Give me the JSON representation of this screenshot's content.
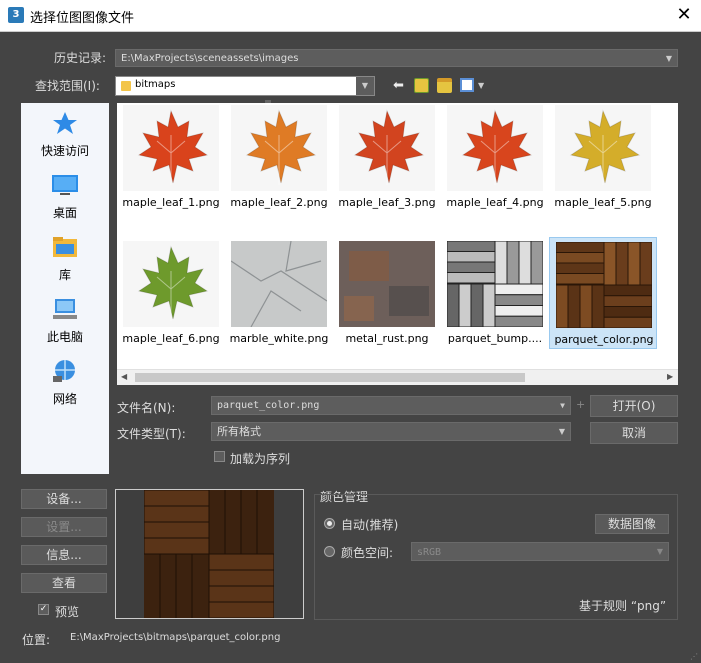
{
  "window": {
    "title": "选择位图图像文件",
    "app_icon_text": "3"
  },
  "history": {
    "label": "历史记录:",
    "value": "E:\\MaxProjects\\sceneassets\\images"
  },
  "lookin": {
    "label": "查找范围(I):",
    "value": "bitmaps"
  },
  "places": [
    {
      "label": "快速访问",
      "icon": "star-icon"
    },
    {
      "label": "桌面",
      "icon": "desktop-icon"
    },
    {
      "label": "库",
      "icon": "library-icon"
    },
    {
      "label": "此电脑",
      "icon": "computer-icon"
    },
    {
      "label": "网络",
      "icon": "network-icon"
    }
  ],
  "files": [
    {
      "name": "maple_leaf_1.png",
      "kind": "leaf",
      "color": "#d9431c"
    },
    {
      "name": "maple_leaf_2.png",
      "kind": "leaf",
      "color": "#df7b25"
    },
    {
      "name": "maple_leaf_3.png",
      "kind": "leaf",
      "color": "#d2441f"
    },
    {
      "name": "maple_leaf_4.png",
      "kind": "leaf",
      "color": "#d8451d"
    },
    {
      "name": "maple_leaf_5.png",
      "kind": "leaf",
      "color": "#d4ad2a"
    },
    {
      "name": "maple_leaf_6.png",
      "kind": "leaf",
      "color": "#6e9a2c"
    },
    {
      "name": "marble_white.png",
      "kind": "marble",
      "color": "#c7c9c9"
    },
    {
      "name": "metal_rust.png",
      "kind": "rust",
      "color": "#6d5f5a"
    },
    {
      "name": "parquet_bump....",
      "kind": "parquet-bw",
      "color": "#8a8a8a"
    },
    {
      "name": "parquet_color.png",
      "kind": "parquet",
      "color": "#6a3f1c",
      "selected": true
    }
  ],
  "filename": {
    "label": "文件名(N):",
    "value": "parquet_color.png"
  },
  "filetype": {
    "label": "文件类型(T):",
    "value": "所有格式"
  },
  "open_button": "打开(O)",
  "cancel_button": "取消",
  "sequence": {
    "label": "加载为序列"
  },
  "side_buttons": {
    "setup": "设备...",
    "settings": "设置...",
    "info": "信息...",
    "view": "查看"
  },
  "preview_check": {
    "label": "预览"
  },
  "color_management": {
    "title": "颜色管理",
    "auto": "自动(推荐)",
    "data_image_button": "数据图像",
    "color_space": "颜色空间:",
    "color_space_value": "sRGB",
    "rule_text": "基于规则 “png”"
  },
  "location": {
    "label": "位置:",
    "value": "E:\\MaxProjects\\bitmaps\\parquet_color.png"
  }
}
